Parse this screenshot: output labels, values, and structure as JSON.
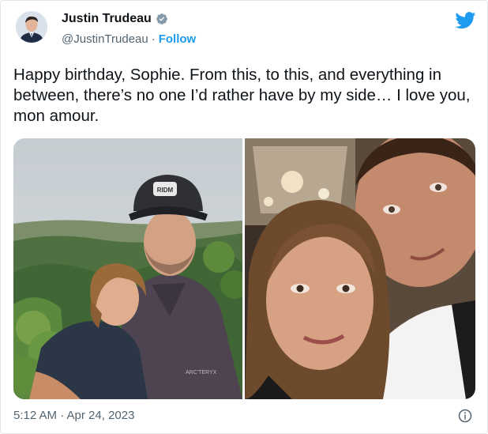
{
  "tweet": {
    "author_name": "Justin Trudeau",
    "handle": "@JustinTrudeau",
    "separator": "·",
    "follow_label": "Follow",
    "text": "Happy birthday, Sophie. From this, to this, and everything in between, there’s no one I’d rather have by my side… I love you, mon amour.",
    "timestamp": "5:12 AM · Apr 24, 2023",
    "cap_text": "RIDM",
    "jacket_text": "ARC'TERYX"
  },
  "icons": {
    "verified": "verified-badge-icon",
    "bird": "twitter-bird-icon",
    "info": "info-icon"
  },
  "colors": {
    "link": "#1d9bf0",
    "muted": "#536471",
    "text": "#0f1419"
  }
}
